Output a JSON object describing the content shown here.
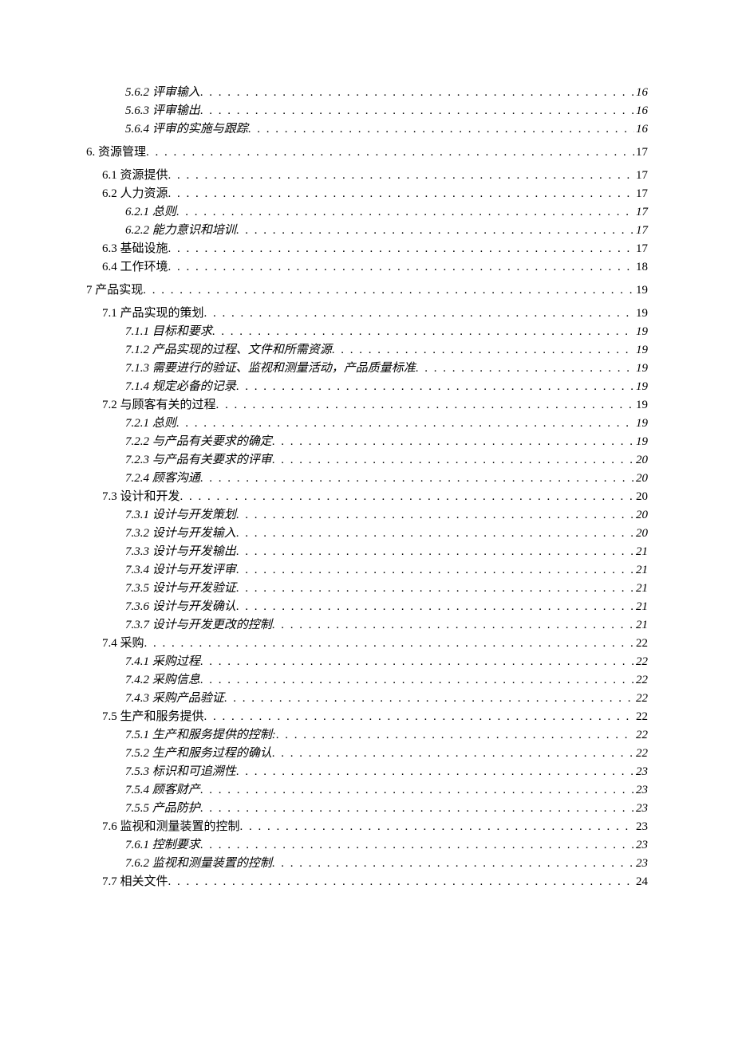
{
  "toc": [
    {
      "level": 3,
      "label": "5.6.2 评审输入",
      "page": "16"
    },
    {
      "level": 3,
      "label": "5.6.3 评审输出",
      "page": "16"
    },
    {
      "level": 3,
      "label": "5.6.4 评审的实施与跟踪",
      "page": "16"
    },
    {
      "level": 1,
      "label": "6. 资源管理",
      "page": "17",
      "top": true
    },
    {
      "level": 2,
      "label": "6.1 资源提供",
      "page": "17"
    },
    {
      "level": 2,
      "label": "6.2 人力资源",
      "page": "17"
    },
    {
      "level": 3,
      "label": "6.2.1 总则",
      "page": "17"
    },
    {
      "level": 3,
      "label": "6.2.2 能力意识和培训",
      "page": "17"
    },
    {
      "level": 2,
      "label": "6.3 基础设施",
      "page": "17"
    },
    {
      "level": 2,
      "label": "6.4 工作环境",
      "page": "18"
    },
    {
      "level": 1,
      "label": "7 产品实现",
      "page": "19",
      "top": true
    },
    {
      "level": 2,
      "label": "7.1 产品实现的策划",
      "page": "19"
    },
    {
      "level": 3,
      "label": "7.1.1 目标和要求",
      "page": "19"
    },
    {
      "level": 3,
      "label": "7.1.2 产品实现的过程、文件和所需资源",
      "page": "19"
    },
    {
      "level": 3,
      "label": "7.1.3 需要进行的验证、监视和测量活动，产品质量标准",
      "page": "19"
    },
    {
      "level": 3,
      "label": "7.1.4 规定必备的记录",
      "page": "19"
    },
    {
      "level": 2,
      "label": "7.2 与顾客有关的过程",
      "page": "19"
    },
    {
      "level": 3,
      "label": "7.2.1 总则",
      "page": "19"
    },
    {
      "level": 3,
      "label": "7.2.2 与产品有关要求的确定",
      "page": "19"
    },
    {
      "level": 3,
      "label": "7.2.3 与产品有关要求的评审",
      "page": "20"
    },
    {
      "level": 3,
      "label": "7.2.4 顾客沟通",
      "page": "20"
    },
    {
      "level": 2,
      "label": "7.3   设计和开发",
      "page": "20"
    },
    {
      "level": 3,
      "label": "7.3.1 设计与开发策划",
      "page": "20"
    },
    {
      "level": 3,
      "label": "7.3.2 设计与开发输入",
      "page": "20"
    },
    {
      "level": 3,
      "label": "7.3.3 设计与开发输出",
      "page": "21"
    },
    {
      "level": 3,
      "label": "7.3.4 设计与开发评审",
      "page": "21"
    },
    {
      "level": 3,
      "label": "7.3.5 设计与开发验证",
      "page": "21"
    },
    {
      "level": 3,
      "label": "7.3.6 设计与开发确认",
      "page": "21"
    },
    {
      "level": 3,
      "label": "7.3.7 设计与开发更改的控制",
      "page": "21"
    },
    {
      "level": 2,
      "label": "7.4 采购",
      "page": "22"
    },
    {
      "level": 3,
      "label": "7.4.1 采购过程",
      "page": "22"
    },
    {
      "level": 3,
      "label": "7.4.2 采购信息",
      "page": "22"
    },
    {
      "level": 3,
      "label": "7.4.3  采购产品验证",
      "page": "22"
    },
    {
      "level": 2,
      "label": "7.5 生产和服务提供",
      "page": "22"
    },
    {
      "level": 3,
      "label": "7.5.1 生产和服务提供的控制:",
      "page": "22"
    },
    {
      "level": 3,
      "label": "7.5.2  生产和服务过程的确认",
      "page": "22"
    },
    {
      "level": 3,
      "label": "7.5.3  标识和可追溯性",
      "page": "23"
    },
    {
      "level": 3,
      "label": "7.5.4  顾客财产",
      "page": "23"
    },
    {
      "level": 3,
      "label": "7.5.5  产品防护",
      "page": "23"
    },
    {
      "level": 2,
      "label": "7.6  监视和测量装置的控制",
      "page": "23"
    },
    {
      "level": 3,
      "label": "7.6.1 控制要求",
      "page": "23"
    },
    {
      "level": 3,
      "label": "7.6.2 监视和测量装置的控制",
      "page": "23"
    },
    {
      "level": 2,
      "label": "7.7  相关文件",
      "page": "24"
    }
  ]
}
